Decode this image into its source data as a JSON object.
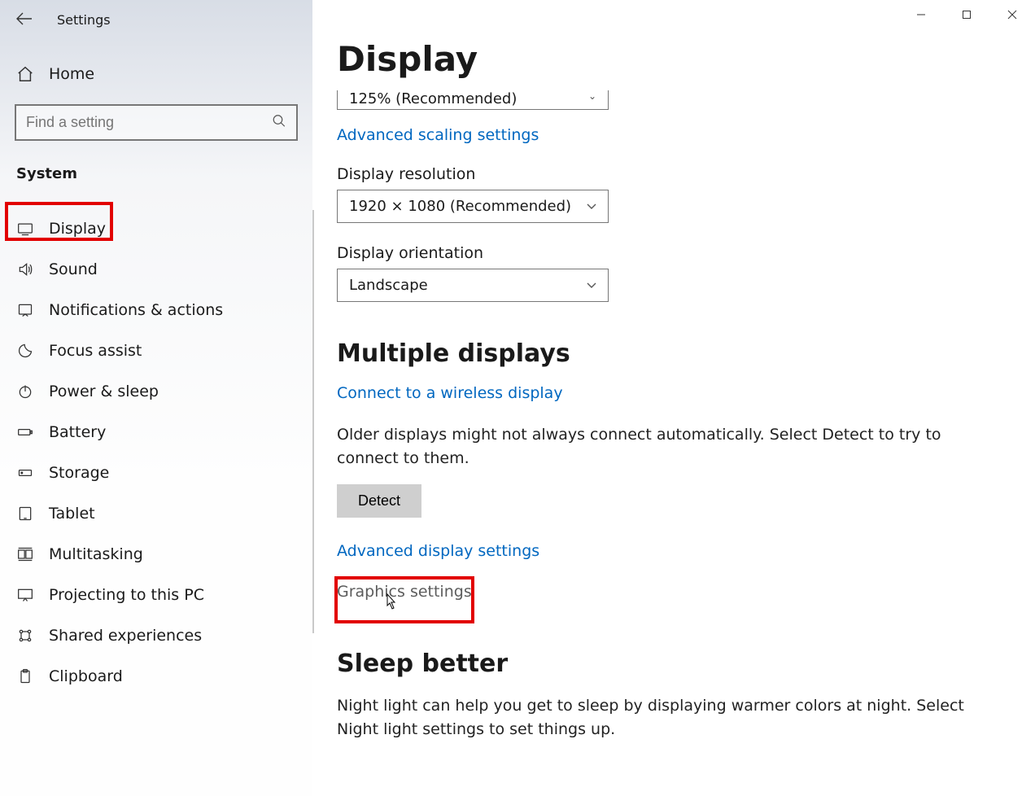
{
  "window": {
    "app_title": "Settings",
    "controls": {
      "minimize": "–",
      "maximize": "▢",
      "close": "✕"
    }
  },
  "sidebar": {
    "home_label": "Home",
    "search_placeholder": "Find a setting",
    "category_heading": "System",
    "items": [
      {
        "id": "display",
        "label": "Display",
        "icon": "display-icon"
      },
      {
        "id": "sound",
        "label": "Sound",
        "icon": "sound-icon"
      },
      {
        "id": "notifications",
        "label": "Notifications & actions",
        "icon": "notifications-icon"
      },
      {
        "id": "focus-assist",
        "label": "Focus assist",
        "icon": "focus-assist-icon"
      },
      {
        "id": "power-sleep",
        "label": "Power & sleep",
        "icon": "power-icon"
      },
      {
        "id": "battery",
        "label": "Battery",
        "icon": "battery-icon"
      },
      {
        "id": "storage",
        "label": "Storage",
        "icon": "storage-icon"
      },
      {
        "id": "tablet",
        "label": "Tablet",
        "icon": "tablet-icon"
      },
      {
        "id": "multitasking",
        "label": "Multitasking",
        "icon": "multitasking-icon"
      },
      {
        "id": "projecting",
        "label": "Projecting to this PC",
        "icon": "projecting-icon"
      },
      {
        "id": "shared-experiences",
        "label": "Shared experiences",
        "icon": "shared-icon"
      },
      {
        "id": "clipboard",
        "label": "Clipboard",
        "icon": "clipboard-icon"
      }
    ]
  },
  "main": {
    "page_title": "Display",
    "scale_value": "125% (Recommended)",
    "advanced_scaling_link": "Advanced scaling settings",
    "resolution_label": "Display resolution",
    "resolution_value": "1920 × 1080 (Recommended)",
    "orientation_label": "Display orientation",
    "orientation_value": "Landscape",
    "multiple_displays_heading": "Multiple displays",
    "connect_wireless_link": "Connect to a wireless display",
    "older_displays_text": "Older displays might not always connect automatically. Select Detect to try to connect to them.",
    "detect_button": "Detect",
    "advanced_display_link": "Advanced display settings",
    "graphics_settings_link": "Graphics settings",
    "sleep_better_heading": "Sleep better",
    "sleep_better_text": "Night light can help you get to sleep by displaying warmer colors at night. Select Night light settings to set things up."
  }
}
